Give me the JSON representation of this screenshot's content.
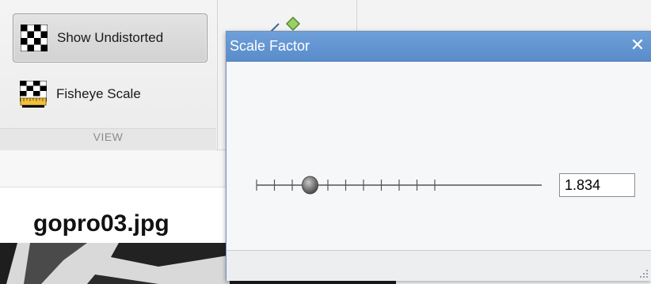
{
  "ribbon": {
    "view_group": {
      "label": "VIEW",
      "buttons": [
        {
          "label": "Show Undistorted",
          "icon": "checkerboard-icon",
          "state": "pressed"
        },
        {
          "label": "Fisheye Scale",
          "icon": "checkerboard-ruler-icon"
        }
      ]
    },
    "partial_icon": "diamond-arrow-icon"
  },
  "content": {
    "image_title": "gopro03.jpg"
  },
  "dialog": {
    "title": "Scale Factor",
    "close_icon": "close-icon",
    "slider": {
      "tick_count": 11,
      "position_fraction": 0.3
    },
    "value": "1.834",
    "resize_grip_icon": "resize-grip-icon"
  },
  "colors": {
    "titlebar": "#5f91d0",
    "dialog_border": "#6f8fbe",
    "ribbon_bg": "#f3f3f3",
    "pressed_button": "#d8d8d8"
  }
}
